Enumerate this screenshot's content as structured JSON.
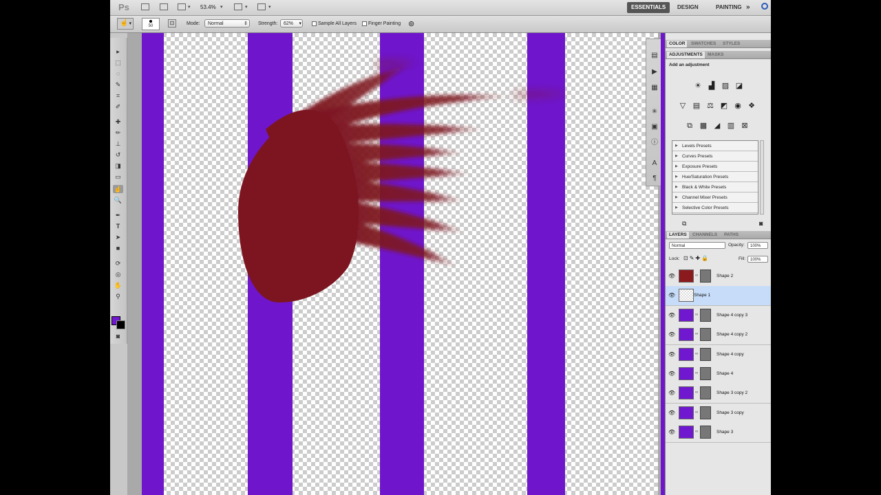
{
  "appbar": {
    "logo": "Ps",
    "zoom": "53.4%",
    "workspaces": [
      "ESSENTIALS",
      "DESIGN",
      "PAINTING",
      "»"
    ]
  },
  "options": {
    "brush_size": "50",
    "mode_label": "Mode:",
    "mode_value": "Normal",
    "strength_label": "Strength:",
    "strength_value": "62%",
    "sample_all_layers": "Sample All Layers",
    "finger_painting": "Finger Painting"
  },
  "colors": {
    "foreground": "#7018d0",
    "background": "#000000",
    "stripe": "#6f16cc",
    "shape": "#7d1520"
  },
  "toolbox_icons": [
    "move-tool",
    "marquee-tool",
    "lasso-tool",
    "quick-select-tool",
    "crop-tool",
    "eyedropper-tool",
    "spot-healing-tool",
    "brush-tool",
    "clone-stamp-tool",
    "history-brush-tool",
    "eraser-tool",
    "gradient-tool",
    "smudge-tool",
    "dodge-tool",
    "pen-tool",
    "type-tool",
    "path-select-tool",
    "shape-tool",
    "3d-rotate-tool",
    "3d-orbit-tool",
    "hand-tool",
    "zoom-tool"
  ],
  "color_panel": {
    "tabs": [
      "COLOR",
      "SWATCHES",
      "STYLES"
    ]
  },
  "adjustments_panel": {
    "tabs": [
      "ADJUSTMENTS",
      "MASKS"
    ],
    "subtitle": "Add an adjustment",
    "presets": [
      "Levels Presets",
      "Curves Presets",
      "Exposure Presets",
      "Hue/Saturation Presets",
      "Black & White Presets",
      "Channel Mixer Presets",
      "Selective Color Presets"
    ]
  },
  "layers_panel": {
    "tabs": [
      "LAYERS",
      "CHANNELS",
      "PATHS"
    ],
    "blend_mode": "Normal",
    "opacity_label": "Opacity:",
    "opacity_value": "100%",
    "lock_label": "Lock:",
    "fill_label": "Fill:",
    "fill_value": "100%",
    "layers": [
      {
        "name": "Shape 2",
        "selected": false,
        "color": "#8a1a1e"
      },
      {
        "name": "Shape 1",
        "selected": true,
        "color": "#ffffff"
      },
      {
        "name": "Shape 4 copy 3",
        "selected": false,
        "color": "#7018d0"
      },
      {
        "name": "Shape 4 copy 2",
        "selected": false,
        "color": "#7018d0"
      },
      {
        "name": "Shape 4 copy",
        "selected": false,
        "color": "#7018d0"
      },
      {
        "name": "Shape 4",
        "selected": false,
        "color": "#7018d0"
      },
      {
        "name": "Shape 3 copy 2",
        "selected": false,
        "color": "#7018d0"
      },
      {
        "name": "Shape 3 copy",
        "selected": false,
        "color": "#7018d0"
      },
      {
        "name": "Shape 3",
        "selected": false,
        "color": "#7018d0"
      }
    ]
  }
}
